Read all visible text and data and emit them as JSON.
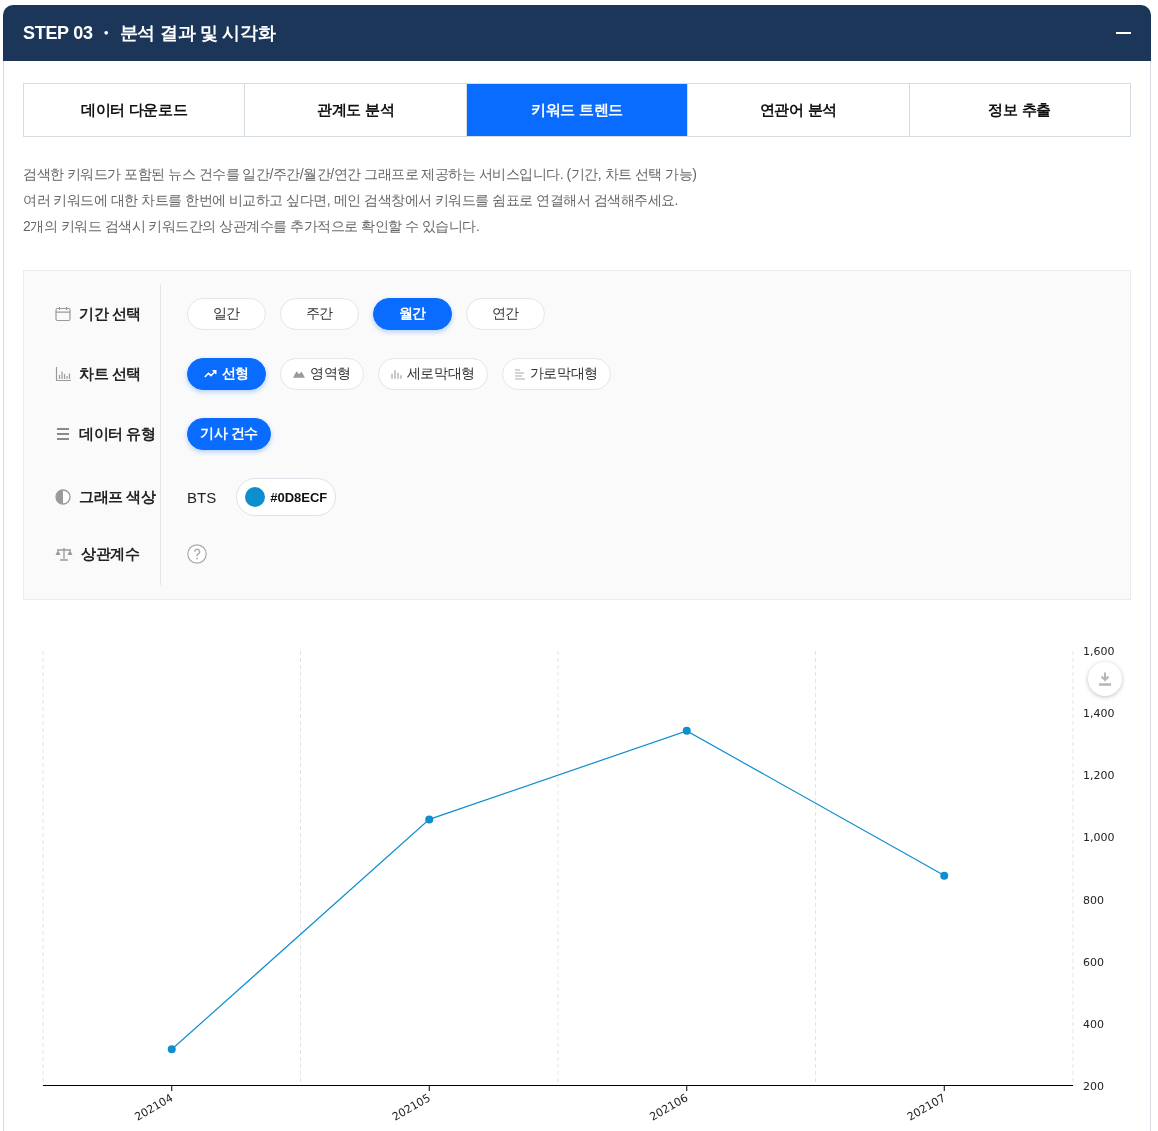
{
  "header": {
    "title": "STEP 03 ・ 분석 결과 및 시각화"
  },
  "tabs": [
    {
      "label": "데이터 다운로드",
      "selected": false
    },
    {
      "label": "관계도 분석",
      "selected": false
    },
    {
      "label": "키워드 트렌드",
      "selected": true
    },
    {
      "label": "연관어 분석",
      "selected": false
    },
    {
      "label": "정보 추출",
      "selected": false
    }
  ],
  "description": [
    "검색한 키워드가 포함된 뉴스 건수를 일간/주간/월간/연간 그래프로 제공하는 서비스입니다. (기간, 차트 선택 가능)",
    "여러 키워드에 대한 차트를 한번에 비교하고 싶다면, 메인 검색창에서 키워드를 쉼표로 연결해서 검색해주세요.",
    "2개의 키워드 검색시 키워드간의 상관계수를 추가적으로 확인할 수 있습니다."
  ],
  "options": [
    {
      "kind": "chips",
      "label": "기간 선택",
      "chips": [
        {
          "label": "일간",
          "selected": false
        },
        {
          "label": "주간",
          "selected": false
        },
        {
          "label": "월간",
          "selected": true
        },
        {
          "label": "연간",
          "selected": false
        }
      ]
    },
    {
      "kind": "chips",
      "label": "차트 선택",
      "chips": [
        {
          "label": "선형",
          "selected": true
        },
        {
          "label": "영역형",
          "selected": false
        },
        {
          "label": "세로막대형",
          "selected": false
        },
        {
          "label": "가로막대형",
          "selected": false
        }
      ]
    },
    {
      "kind": "chips",
      "label": "데이터 유형",
      "chips": [
        {
          "label": "기사 건수",
          "selected": true
        }
      ]
    },
    {
      "kind": "color",
      "label": "그래프 색상",
      "keyword": "BTS",
      "color": "#0d8ecf",
      "value": "#0D8ECF"
    },
    {
      "kind": "help",
      "label": "상관계수"
    }
  ],
  "chart": {
    "chart_data": {
      "type": "line",
      "categories": [
        "202104",
        "202105",
        "202106",
        "202107"
      ],
      "series": [
        {
          "color": "#0d8ecf",
          "marker": true,
          "values": [
            318,
            1058,
            1343,
            877
          ]
        }
      ],
      "ylim": [
        200,
        1600
      ],
      "yticks": [
        200,
        400,
        600,
        800,
        {
          "value": 1000,
          "label": "1,000"
        },
        {
          "value": 1200,
          "label": "1,200"
        },
        {
          "value": 1400,
          "label": "1,400"
        },
        {
          "value": 1600,
          "label": "1,600"
        }
      ]
    }
  }
}
